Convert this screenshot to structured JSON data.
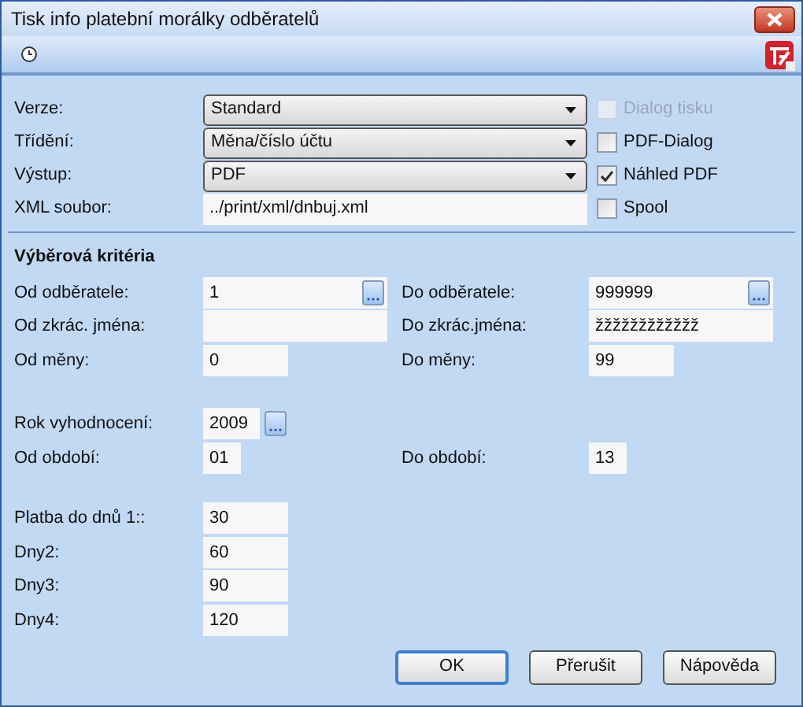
{
  "window": {
    "title": "Tisk info platební morálky odběratelů"
  },
  "options": [
    {
      "label": "Verze:",
      "kind": "dropdown",
      "value": "Standard"
    },
    {
      "label": "Třídění:",
      "kind": "dropdown",
      "value": "Měna/číslo účtu"
    },
    {
      "label": "Výstup:",
      "kind": "dropdown",
      "value": "PDF"
    },
    {
      "label": "XML soubor:",
      "kind": "text",
      "value": "../print/xml/dnbuj.xml"
    }
  ],
  "checkboxes": [
    {
      "label": "Dialog tisku",
      "checked": false,
      "disabled": true
    },
    {
      "label": "PDF-Dialog",
      "checked": false,
      "disabled": false
    },
    {
      "label": "Náhled PDF",
      "checked": true,
      "disabled": false
    },
    {
      "label": "Spool",
      "checked": false,
      "disabled": false
    }
  ],
  "criteria": {
    "title": "Výběrová kritéria",
    "groups": [
      {
        "rows": [
          {
            "left": {
              "label": "Od odběratele:",
              "value": "1",
              "kind": "wide",
              "browse": true
            },
            "right": {
              "label": "Do odběratele:",
              "value": "999999",
              "kind": "wide",
              "browse": true
            }
          },
          {
            "left": {
              "label": "Od zkrác. jména:",
              "kind": "wide",
              "browse": false
            },
            "right": {
              "label": "Do zkrác.jména:",
              "value": "žžžžžžžžžžžž",
              "kind": "wide",
              "browse": false
            }
          },
          {
            "left": {
              "label": "Od měny:",
              "value": "0",
              "kind": "short",
              "browse": false
            },
            "right": {
              "label": "Do měny:",
              "value": "99",
              "kind": "short",
              "browse": false
            }
          }
        ]
      },
      {
        "rows": [
          {
            "left": {
              "label": "Rok vyhodnocení:",
              "value": "2009",
              "kind": "year",
              "browse": true
            }
          },
          {
            "left": {
              "label": "Od období:",
              "value": "01",
              "kind": "tiny",
              "browse": false
            },
            "right": {
              "label": "Do období:",
              "value": "13",
              "kind": "tiny",
              "browse": false
            }
          }
        ]
      },
      {
        "rows": [
          {
            "left": {
              "label": "Platba do dnů 1::",
              "value": "30",
              "kind": "short",
              "browse": false
            }
          },
          {
            "left": {
              "label": "Dny2:",
              "value": "60",
              "kind": "short",
              "browse": false
            }
          },
          {
            "left": {
              "label": "Dny3:",
              "value": "90",
              "kind": "short",
              "browse": false
            }
          },
          {
            "left": {
              "label": "Dny4:",
              "value": "120",
              "kind": "short",
              "browse": false
            }
          }
        ]
      }
    ]
  },
  "buttons": [
    {
      "label": "OK",
      "selected": true
    },
    {
      "label": "Přerušit",
      "selected": false
    },
    {
      "label": "Nápověda",
      "selected": false
    }
  ]
}
